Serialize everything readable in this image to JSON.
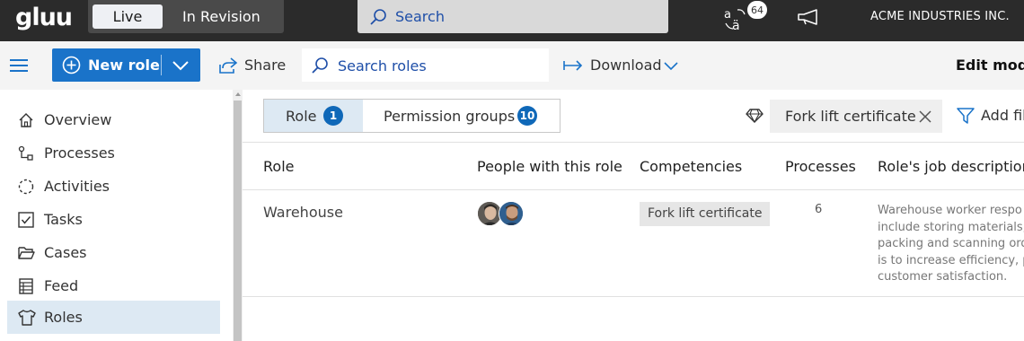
{
  "app": {
    "logo": "gluu",
    "modes": [
      "Live",
      "In Revision"
    ],
    "search_placeholder": "Search",
    "notification_count": "64",
    "company": "ACME INDUSTRIES INC."
  },
  "toolbar": {
    "new_role_label": "New role",
    "share_label": "Share",
    "search_placeholder": "Search roles",
    "download_label": "Download",
    "mode_label": "Edit mode"
  },
  "sidebar": {
    "items": [
      {
        "label": "Overview",
        "icon": "home-icon"
      },
      {
        "label": "Processes",
        "icon": "process-icon"
      },
      {
        "label": "Activities",
        "icon": "activities-icon"
      },
      {
        "label": "Tasks",
        "icon": "tasks-icon"
      },
      {
        "label": "Cases",
        "icon": "folder-icon"
      },
      {
        "label": "Feed",
        "icon": "feed-icon"
      },
      {
        "label": "Roles",
        "icon": "shirt-icon",
        "active": true
      }
    ]
  },
  "tabs": [
    {
      "label": "Role",
      "count": "1",
      "active": true
    },
    {
      "label": "Permission groups",
      "count": "10"
    }
  ],
  "filters": {
    "active": "Fork lift certificate",
    "add_label": "Add fil"
  },
  "table": {
    "columns": [
      "Role",
      "People with this role",
      "Competencies",
      "Processes",
      "Role's job description"
    ],
    "rows": [
      {
        "role": "Warehouse",
        "people_count": 2,
        "competency": "Fork lift certificate",
        "processes": "6",
        "description_lines": [
          "Warehouse worker respo",
          "include storing materials,",
          "packing and scanning ord",
          "is to increase efficiency, p",
          "customer satisfaction."
        ]
      }
    ]
  },
  "colors": {
    "topbar": "#2b2b2b",
    "primary": "#1a73c9",
    "active_nav": "#dde9f3",
    "count_badge": "#0f68b8"
  }
}
